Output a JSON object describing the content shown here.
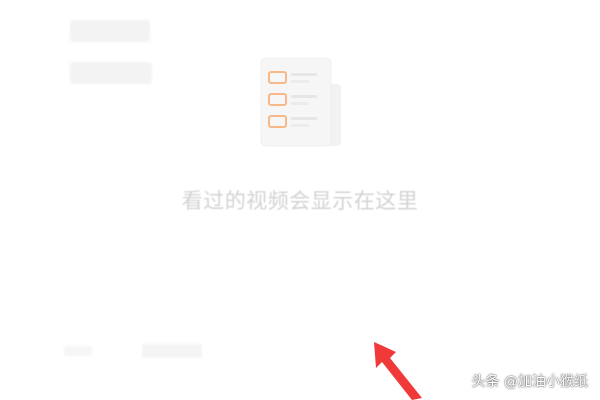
{
  "empty_state": {
    "message": "看过的视频会显示在这里",
    "icon": "history-list-icon",
    "accent_color": "#f7b98a",
    "text_color": "#d3d3d3"
  },
  "annotation": {
    "icon": "red-arrow-icon",
    "color": "#f03a3a"
  },
  "watermark": {
    "text": "头条 @加油小猴纸"
  }
}
